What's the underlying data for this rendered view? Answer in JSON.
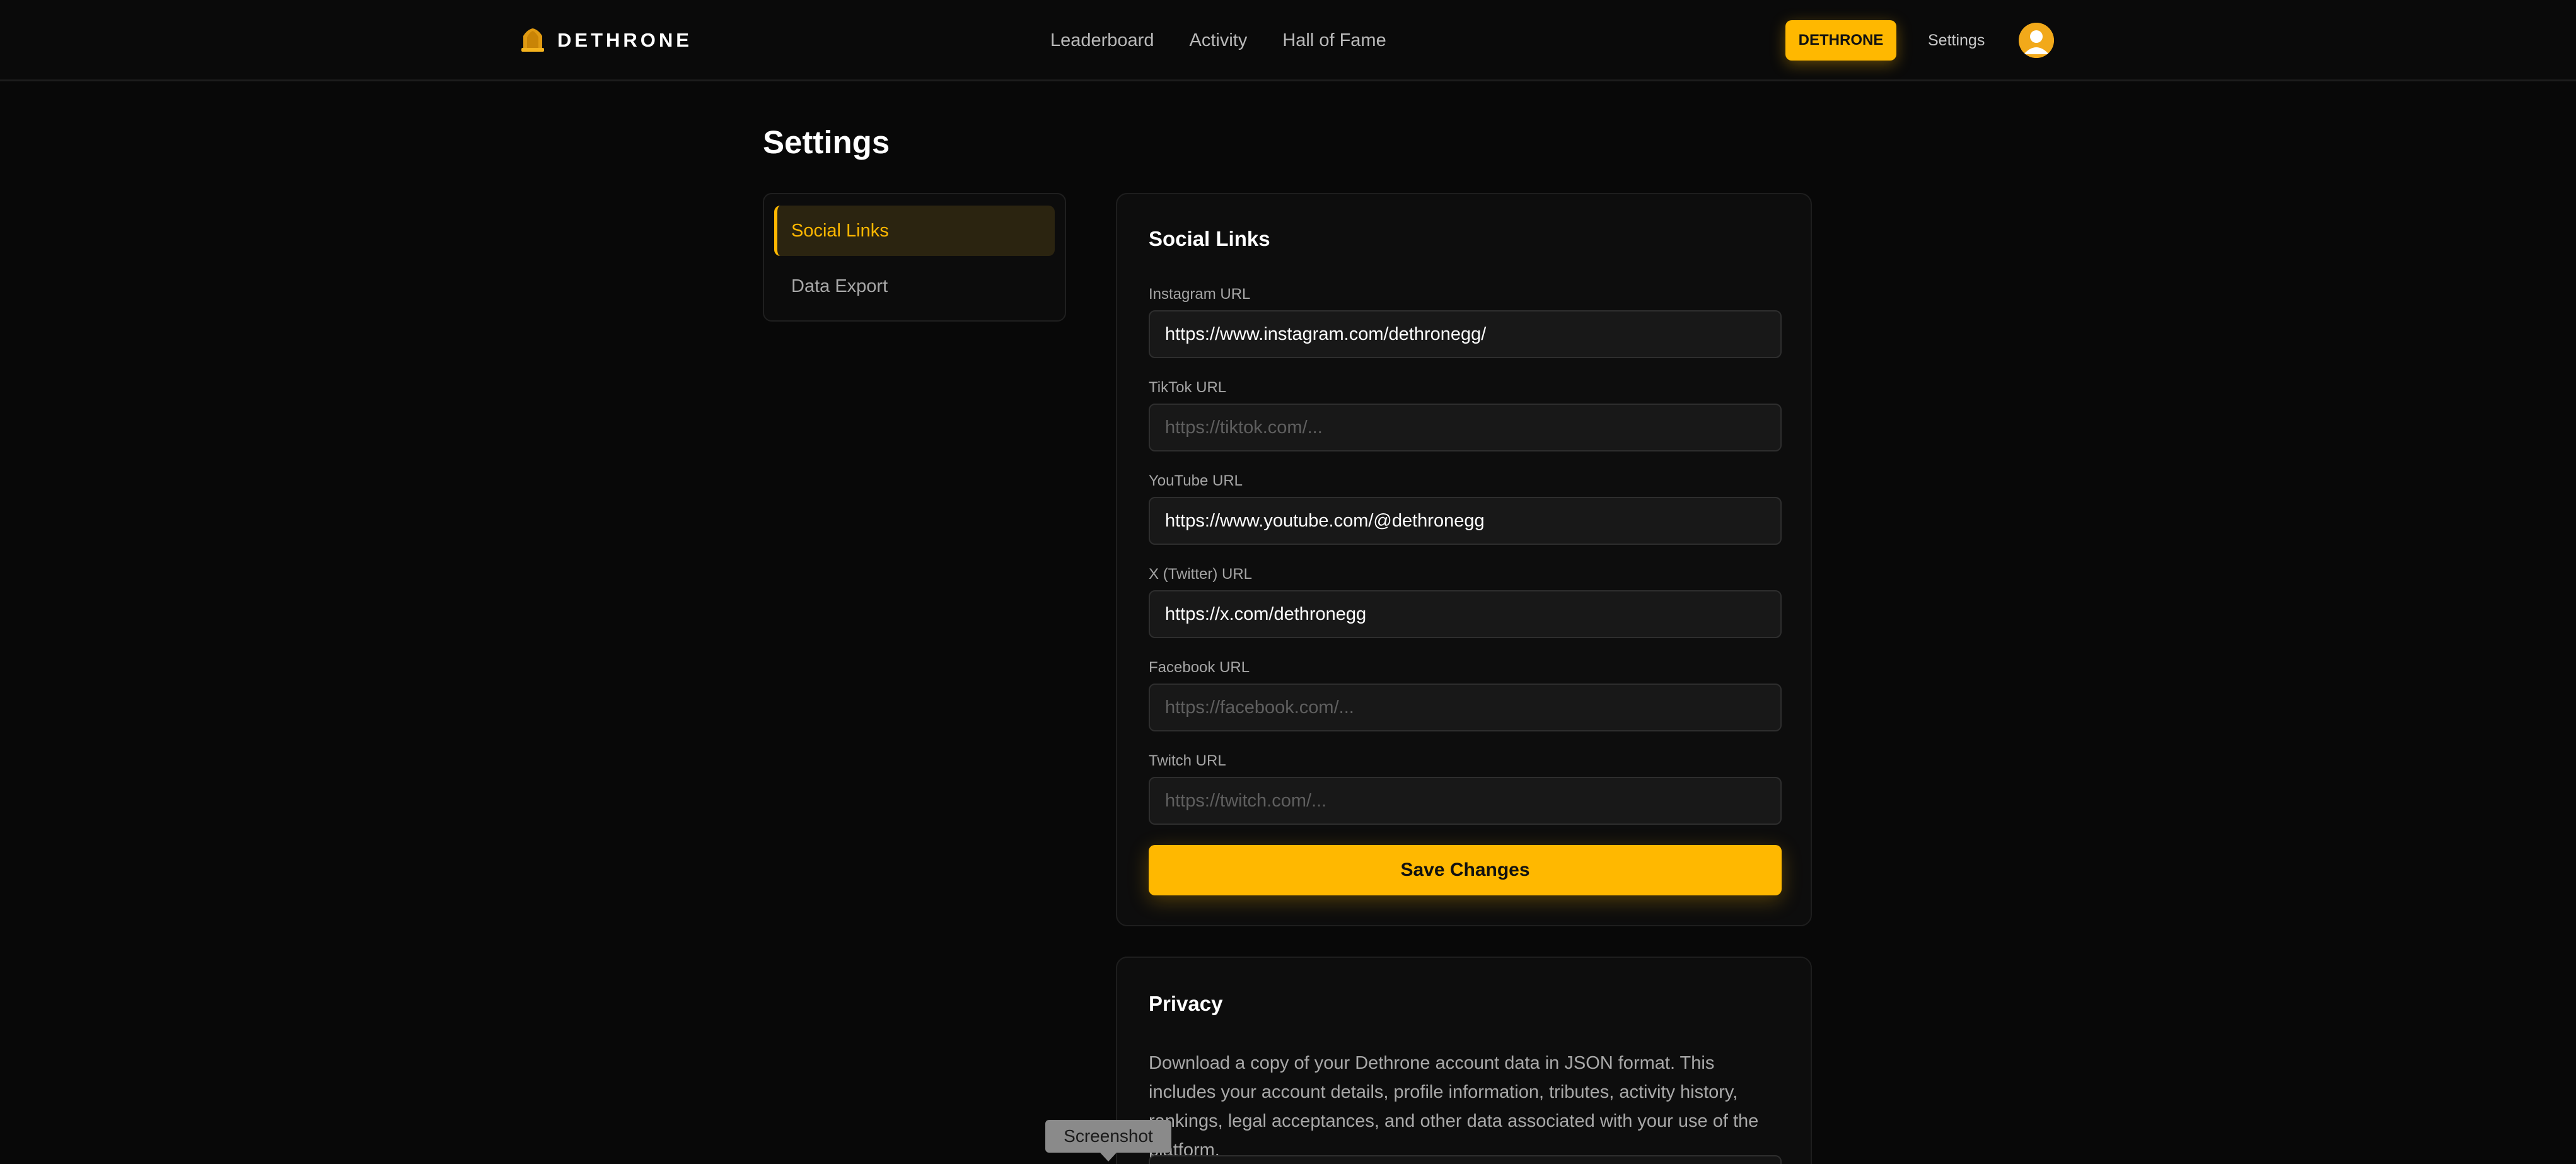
{
  "header": {
    "brand_name": "DETHRONE",
    "nav": [
      {
        "label": "Leaderboard"
      },
      {
        "label": "Activity"
      },
      {
        "label": "Hall of Fame"
      }
    ],
    "cta_label": "DETHRONE",
    "settings_label": "Settings"
  },
  "page": {
    "title": "Settings"
  },
  "menu": {
    "items": [
      {
        "label": "Social Links",
        "active": true
      },
      {
        "label": "Data Export",
        "active": false
      }
    ]
  },
  "social": {
    "title": "Social Links",
    "fields": [
      {
        "label": "Instagram URL",
        "value": "https://www.instagram.com/dethronegg/",
        "placeholder": ""
      },
      {
        "label": "TikTok URL",
        "value": "",
        "placeholder": "https://tiktok.com/..."
      },
      {
        "label": "YouTube URL",
        "value": "https://www.youtube.com/@dethronegg",
        "placeholder": ""
      },
      {
        "label": "X (Twitter) URL",
        "value": "https://x.com/dethronegg",
        "placeholder": ""
      },
      {
        "label": "Facebook URL",
        "value": "",
        "placeholder": "https://facebook.com/..."
      },
      {
        "label": "Twitch URL",
        "value": "",
        "placeholder": "https://twitch.com/..."
      }
    ],
    "save_label": "Save Changes"
  },
  "privacy": {
    "title": "Privacy",
    "description": "Download a copy of your Dethrone account data in JSON format. This includes your account details, profile information, tributes, activity history, rankings, legal acceptances, and other data associated with your use of the platform."
  },
  "tooltip": {
    "label": "Screenshot"
  },
  "colors": {
    "accent": "#ffb800",
    "background": "#080808",
    "card": "#0d0d0d",
    "input": "#181818"
  },
  "icons": {
    "brand": "crown-icon",
    "avatar": "user-avatar-icon"
  }
}
